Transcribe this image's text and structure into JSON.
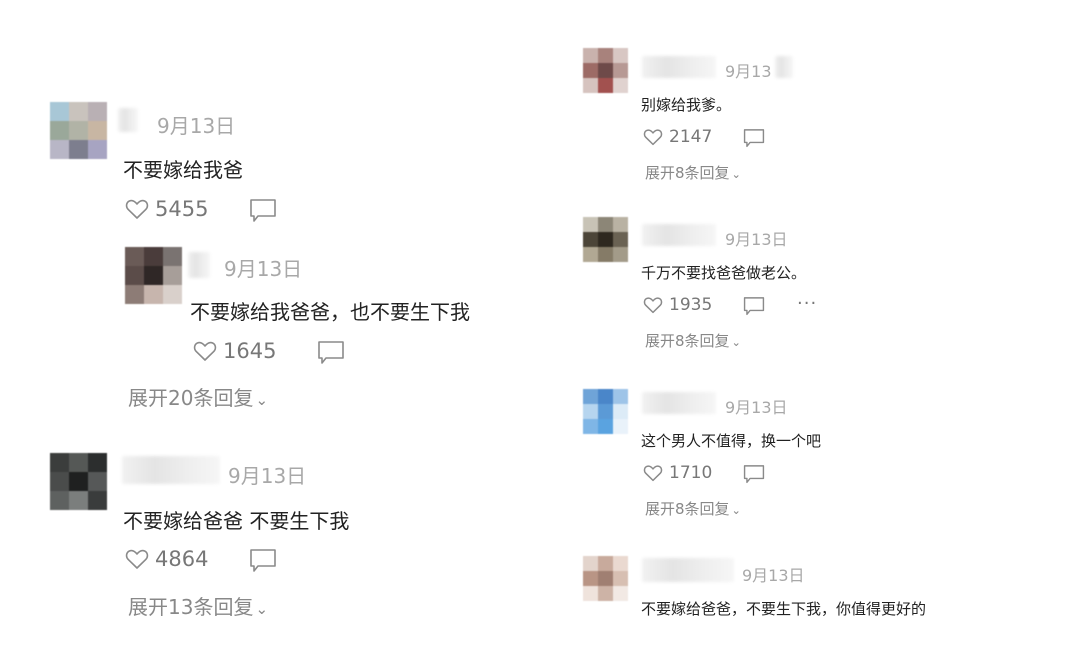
{
  "left": {
    "comment1": {
      "date": "9月13日",
      "text": "不要嫁给我爸",
      "likes": "5455",
      "reply": {
        "date": "9月13日",
        "text": "不要嫁给我爸爸，也不要生下我",
        "likes": "1645"
      },
      "expand": "展开20条回复"
    },
    "comment2": {
      "date": "9月13日",
      "text": "不要嫁给爸爸 不要生下我",
      "likes": "4864",
      "expand": "展开13条回复"
    }
  },
  "right": {
    "comment1": {
      "date": "9月13",
      "text": "别嫁给我爹。",
      "likes": "2147",
      "expand": "展开8条回复"
    },
    "comment2": {
      "date": "9月13日",
      "text": "千万不要找爸爸做老公。",
      "likes": "1935",
      "more": "···",
      "expand": "展开8条回复"
    },
    "comment3": {
      "date": "9月13日",
      "text": "这个男人不值得，换一个吧",
      "likes": "1710",
      "expand": "展开8条回复"
    },
    "comment4": {
      "date": "9月13日",
      "text": "不要嫁给爸爸，不要生下我，你值得更好的"
    }
  },
  "icons": {
    "like": "heart-outline-icon",
    "comment": "comment-bubble-icon",
    "expand": "chevron-down-icon"
  }
}
